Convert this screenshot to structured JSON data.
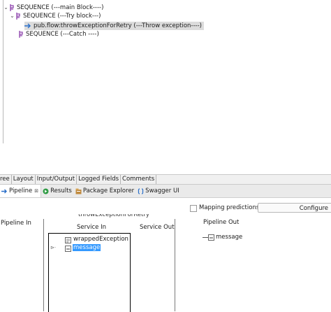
{
  "tree": {
    "rows": [
      {
        "label": "SEQUENCE (---main Block----)",
        "twist": "⌄"
      },
      {
        "label": "SEQUENCE (---Try block---)",
        "twist": "⌄"
      },
      {
        "label": "pub.flow:throwExceptionForRetry (---Throw exception----)",
        "selected": true
      },
      {
        "label": "SEQUENCE (---Catch ----)"
      }
    ]
  },
  "editor_tabs": [
    "ree",
    "Layout",
    "Input/Output",
    "Logged Fields",
    "Comments"
  ],
  "view_tabs": [
    {
      "label": "Pipeline",
      "icon": "pipeline-icon",
      "active": true,
      "close": "⊠"
    },
    {
      "label": "Results",
      "icon": "results-icon"
    },
    {
      "label": "Package Explorer",
      "icon": "package-explorer-icon"
    },
    {
      "label": "Swagger UI",
      "icon": "swagger-icon"
    }
  ],
  "pipeline": {
    "mapping_predictions": "Mapping predictions",
    "configure": "Configure",
    "pipeline_in": "Pipeline In",
    "service_name": "throwExceptionForRetry",
    "service_in": "Service In",
    "service_out": "Service Out",
    "pipeline_out": "Pipeline Out",
    "service_in_fields": [
      "wrappedException",
      "message"
    ],
    "pipeline_out_fields": [
      "message"
    ]
  },
  "colors": {
    "sequence_icon": "#8e44ad",
    "selection": "#3399ff",
    "selected_row": "#dcdcdc"
  }
}
